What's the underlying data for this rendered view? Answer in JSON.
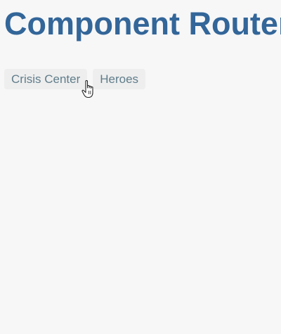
{
  "header": {
    "title": "Component Router"
  },
  "nav": {
    "items": [
      {
        "label": "Crisis Center"
      },
      {
        "label": "Heroes"
      }
    ]
  },
  "cursor": {
    "icon": "hand-pointer-icon"
  },
  "colors": {
    "title": "#336699",
    "nav_text": "#607d8b",
    "nav_bg": "#eeeeee",
    "page_bg": "#f7f7f7"
  }
}
